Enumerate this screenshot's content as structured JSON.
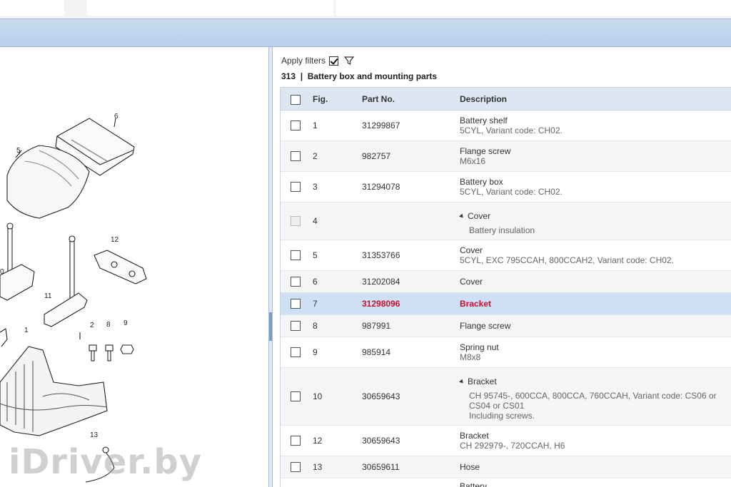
{
  "filters": {
    "label": "Apply filters",
    "checked": true
  },
  "section": {
    "title": "313  |  Battery box and mounting parts"
  },
  "table": {
    "headers": {
      "fig": "Fig.",
      "part_no": "Part No.",
      "description": "Description"
    },
    "rows": [
      {
        "fig": "1",
        "part_no": "31299867",
        "description": "Battery shelf",
        "detail": "5CYL, Variant code: CH02."
      },
      {
        "fig": "2",
        "part_no": "982757",
        "description": "Flange screw",
        "detail": "M6x16"
      },
      {
        "fig": "3",
        "part_no": "31294078",
        "description": "Battery box",
        "detail": "5CYL, Variant code: CH02."
      },
      {
        "fig": "4",
        "part_no": "",
        "description": "Cover",
        "detail": "Battery insulation"
      },
      {
        "fig": "5",
        "part_no": "31353766",
        "description": "Cover",
        "detail": "5CYL, EXC 795CCAH, 800CCAH2, Variant code: CH02."
      },
      {
        "fig": "6",
        "part_no": "31202084",
        "description": "Cover",
        "detail": ""
      },
      {
        "fig": "7",
        "part_no": "31298096",
        "description": "Bracket",
        "detail": ""
      },
      {
        "fig": "8",
        "part_no": "987991",
        "description": "Flange screw",
        "detail": ""
      },
      {
        "fig": "9",
        "part_no": "985914",
        "description": "Spring nut",
        "detail": "M8x8"
      },
      {
        "fig": "10",
        "part_no": "30659643",
        "description": "Bracket",
        "detail": "CH 95745-, 600CCA, 800CCA, 760CCAH, Variant code: CS06 or",
        "detail2": "CS04 or CS01",
        "detail3": "Including screws."
      },
      {
        "fig": "12",
        "part_no": "30659643",
        "description": "Bracket",
        "detail": "CH 292979-, 720CCAH, H6"
      },
      {
        "fig": "13",
        "part_no": "30659611",
        "description": "Hose",
        "detail": ""
      },
      {
        "fig": "",
        "part_no": "",
        "description": "Battery",
        "detail": ""
      }
    ]
  },
  "diagram": {
    "callouts": [
      "6",
      "5",
      "12",
      "0",
      "11",
      "1",
      "2",
      "8",
      "9",
      "13"
    ]
  },
  "watermark": "iDriver.by",
  "colors": {
    "accent_band": "#c9dcf0",
    "selected_row": "#cfe0f4",
    "highlight_text": "#c8102e",
    "header_bg": "#dde7f3"
  }
}
